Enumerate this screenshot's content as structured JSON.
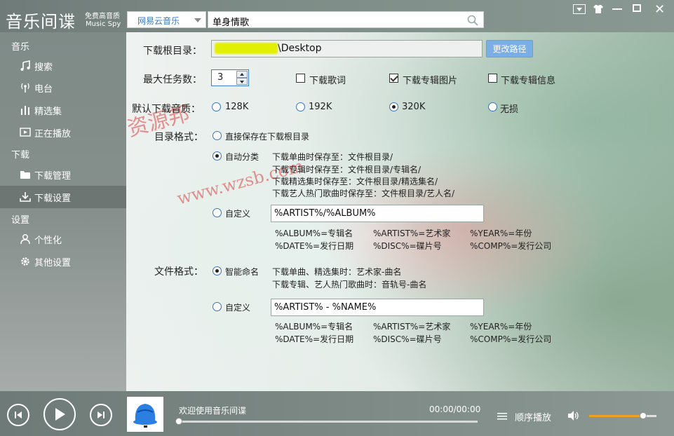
{
  "app": {
    "title": "音乐间谍",
    "subtitle_cn": "免费高音质",
    "subtitle_en": "Music  Spy"
  },
  "header": {
    "source": "网易云音乐",
    "search_value": "单身情歌"
  },
  "sidebar": {
    "sections": [
      {
        "label": "音乐"
      },
      {
        "label": "下载"
      },
      {
        "label": "设置"
      }
    ],
    "items": [
      {
        "label": "搜索",
        "icon": "music-note-icon"
      },
      {
        "label": "电台",
        "icon": "radio-icon"
      },
      {
        "label": "精选集",
        "icon": "bars-icon"
      },
      {
        "label": "正在播放",
        "icon": "play-screen-icon"
      },
      {
        "label": "下载管理",
        "icon": "folder-icon"
      },
      {
        "label": "下载设置",
        "icon": "download-icon",
        "active": true
      },
      {
        "label": "个性化",
        "icon": "user-icon"
      },
      {
        "label": "其他设置",
        "icon": "gear-icon"
      }
    ]
  },
  "settings": {
    "root_dir_label": "下载根目录：",
    "root_dir_value": "\\Desktop",
    "change_path_button": "更改路径",
    "max_tasks_label": "最大任务数：",
    "max_tasks_value": "3",
    "checkboxes": [
      {
        "label": "下载歌词",
        "checked": false
      },
      {
        "label": "下载专辑图片",
        "checked": true
      },
      {
        "label": "下载专辑信息",
        "checked": false
      }
    ],
    "quality_label": "默认下载音质：",
    "quality_options": [
      {
        "label": "128K",
        "checked": false
      },
      {
        "label": "192K",
        "checked": false
      },
      {
        "label": "320K",
        "checked": true
      },
      {
        "label": "无损",
        "checked": false
      }
    ],
    "dir_format_label": "目录格式：",
    "dir_option_direct": "直接保存在下载根目录",
    "dir_option_auto": "自动分类",
    "dir_auto_rules": [
      "下载单曲时保存至：文件根目录/",
      "下载专辑时保存至：文件根目录/专辑名/",
      "下载精选集时保存至：文件根目录/精选集名/",
      "下载艺人热门歌曲时保存至：文件根目录/艺人名/"
    ],
    "dir_option_custom": "自定义",
    "dir_custom_value": "%ARTIST%/%ALBUM%",
    "dir_vars_row1": [
      "%ALBUM%=专辑名",
      "%ARTIST%=艺术家",
      "%YEAR%=年份"
    ],
    "dir_vars_row2": [
      "%DATE%=发行日期",
      "%DISC%=碟片号",
      "%COMP%=发行公司"
    ],
    "file_format_label": "文件格式：",
    "file_option_smart": "智能命名",
    "file_smart_rules": [
      "下载单曲、精选集时：艺术家-曲名",
      "下载专辑、艺人热门歌曲时：音轨号-曲名"
    ],
    "file_option_custom": "自定义",
    "file_custom_value": "%ARTIST% - %NAME%",
    "file_vars_row1": [
      "%ALBUM%=专辑名",
      "%ARTIST%=艺术家",
      "%YEAR%=年份"
    ],
    "file_vars_row2": [
      "%DATE%=发行日期",
      "%DISC%=碟片号",
      "%COMP%=发行公司"
    ],
    "dir_mode": "auto",
    "file_mode": "smart"
  },
  "watermark": {
    "line1": "资源邦",
    "line2": "www.wzsb.com"
  },
  "player": {
    "welcome": "欢迎使用音乐间谍",
    "time": "00:00/00:00",
    "mode": "顺序播放",
    "progress": 0,
    "volume": 0.8
  },
  "colors": {
    "accent": "#3a79c0",
    "button": "#7aaee6",
    "volume": "#f0a020"
  }
}
